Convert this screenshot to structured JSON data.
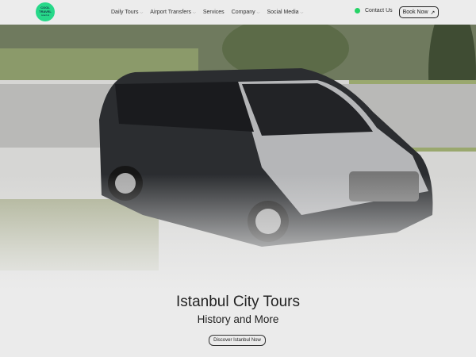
{
  "header": {
    "logo": {
      "line1": "COOL",
      "line2": "TRAVEL",
      "line3": "istanbul"
    },
    "nav": [
      {
        "label": "Daily Tours",
        "dropdown": true
      },
      {
        "label": "Airport Transfers",
        "dropdown": true
      },
      {
        "label": "Services",
        "dropdown": false
      },
      {
        "label": "Company",
        "dropdown": true
      },
      {
        "label": "Social Media",
        "dropdown": true
      }
    ],
    "contact_label": "Contact Us",
    "contact_icon": "whatsapp-icon",
    "book_label": "Book Now",
    "book_icon": "arrow-up-right-icon"
  },
  "hero": {
    "title": "Istanbul City Tours",
    "subtitle": "History and More",
    "cta_label": "Discover Istanbul Now"
  },
  "colors": {
    "brand": "#27d889",
    "whatsapp": "#25d366"
  }
}
